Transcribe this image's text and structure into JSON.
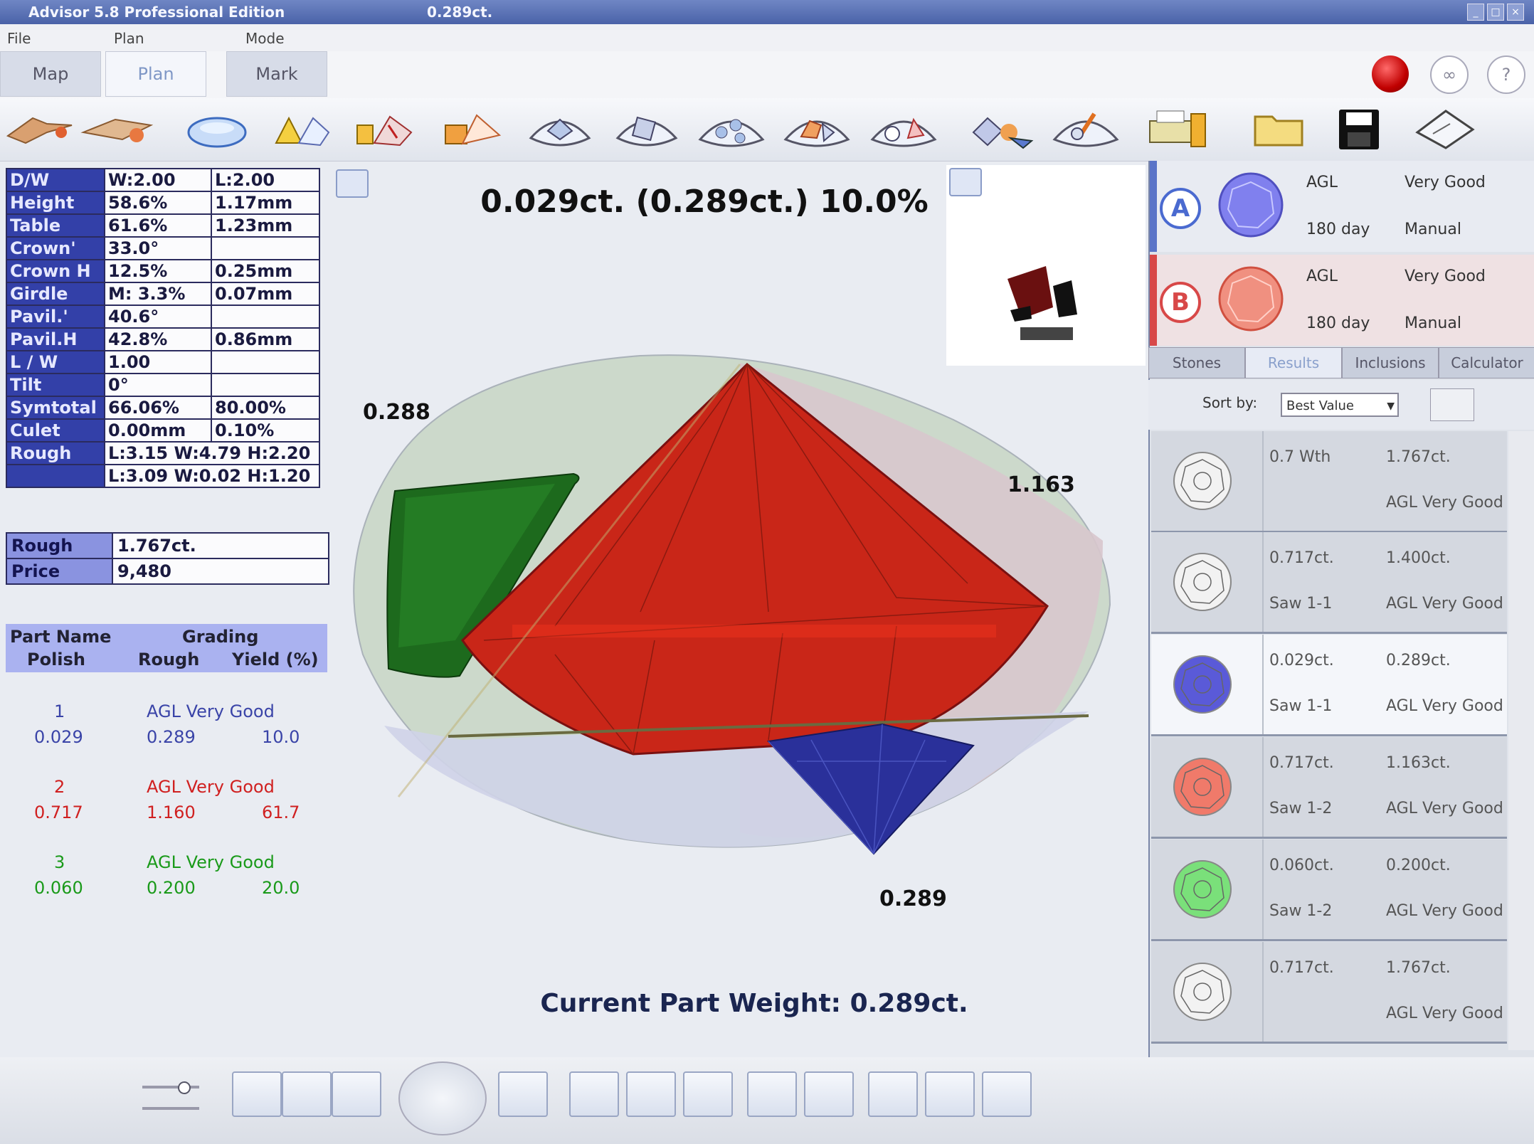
{
  "window": {
    "title": "Advisor 5.8 Professional Edition",
    "title_right": "0.289ct."
  },
  "menu": [
    "File",
    "Plan",
    "Mode"
  ],
  "tabs": [
    {
      "label": "Map",
      "active": false
    },
    {
      "label": "Plan",
      "active": true
    },
    {
      "label": "Mark",
      "active": false
    }
  ],
  "top_right_buttons": [
    "stop-icon",
    "glasses-icon",
    "help-icon"
  ],
  "toolbar_icons": [
    "laser-icon",
    "laser-alt-icon",
    "oval-stone-icon",
    "warning-stone-icon",
    "ruby-stone-icon",
    "multi-stone-icon",
    "round-cut-icon",
    "square-cut-icon",
    "cluster-icon",
    "heart-cut-icon",
    "pear-cut-icon",
    "group-icon",
    "tools-icon",
    "printer-icon",
    "folder-icon",
    "save-icon",
    "rough-stone-icon"
  ],
  "params": [
    {
      "label": "D/W",
      "v1": "W:2.00",
      "v2": "L:2.00"
    },
    {
      "label": "Height",
      "v1": "58.6%",
      "v2": "1.17mm"
    },
    {
      "label": "Table",
      "v1": "61.6%",
      "v2": "1.23mm"
    },
    {
      "label": "Crown'",
      "v1": "33.0°",
      "v2": ""
    },
    {
      "label": "Crown H",
      "v1": "12.5%",
      "v2": "0.25mm"
    },
    {
      "label": "Girdle",
      "v1": "M: 3.3%",
      "v2": "0.07mm"
    },
    {
      "label": "Pavil.'",
      "v1": "40.6°",
      "v2": ""
    },
    {
      "label": "Pavil.H",
      "v1": "42.8%",
      "v2": "0.86mm"
    },
    {
      "label": "L / W",
      "v1": "1.00",
      "v2": ""
    },
    {
      "label": "Tilt",
      "v1": "0°",
      "v2": ""
    },
    {
      "label": "Symtotal",
      "v1": "66.06%",
      "v2": "80.00%"
    },
    {
      "label": "Culet",
      "v1": "0.00mm",
      "v2": "0.10%"
    },
    {
      "label": "Rough",
      "v1": "L:3.15 W:4.79 H:2.20",
      "v2": ""
    },
    {
      "label": "",
      "v1": "L:3.09 W:0.02 H:1.20",
      "v2": ""
    }
  ],
  "rough_summary": [
    {
      "label": "Rough",
      "value": "1.767ct."
    },
    {
      "label": "Price",
      "value": "9,480"
    }
  ],
  "parts_header": {
    "part_name": "Part Name",
    "grading": "Grading",
    "polish": "Polish",
    "rough": "Rough",
    "yield": "Yield (%)"
  },
  "parts": [
    {
      "name": "1",
      "grading": "AGL Very Good",
      "polish": "0.029",
      "rough": "0.289",
      "yield": "10.0",
      "color": "#3a44a8"
    },
    {
      "name": "2",
      "grading": "AGL Very Good",
      "polish": "0.717",
      "rough": "1.160",
      "yield": "61.7",
      "color": "#d02020"
    },
    {
      "name": "3",
      "grading": "AGL Very Good",
      "polish": "0.060",
      "rough": "0.200",
      "yield": "20.0",
      "color": "#1a9a1a"
    }
  ],
  "headline": "0.029ct. (0.289ct.) 10.0%",
  "stone_labels": {
    "green": "0.288",
    "red": "1.163",
    "blue": "0.289"
  },
  "current_part_weight": "Current Part Weight: 0.289ct.",
  "options": [
    {
      "badge": "A",
      "grade": "AGL",
      "quality": "Very Good",
      "price": "180 day",
      "mode": "Manual",
      "color": "#4a5acc"
    },
    {
      "badge": "B",
      "grade": "AGL",
      "quality": "Very Good",
      "price": "180 day",
      "mode": "Manual",
      "color": "#d84040"
    }
  ],
  "right_tabs": [
    {
      "label": "Stones",
      "active": false
    },
    {
      "label": "Results",
      "active": true
    },
    {
      "label": "Inclusions",
      "active": false
    },
    {
      "label": "Calculator",
      "active": false
    }
  ],
  "sort": {
    "label": "Sort by:",
    "value": "Best Value"
  },
  "candidates": [
    {
      "w1": "0.7 Wth",
      "w2": "1.767ct.",
      "sub1": "",
      "sub2": "AGL Very Good",
      "color": "#c9c9c9",
      "selected": false
    },
    {
      "w1": "0.717ct.",
      "w2": "1.400ct.",
      "sub1": "Saw 1-1",
      "sub2": "AGL Very Good",
      "color": "#c9c9c9",
      "selected": false
    },
    {
      "w1": "0.029ct.",
      "w2": "0.289ct.",
      "sub1": "Saw 1-1",
      "sub2": "AGL Very Good",
      "color": "#5a5ad8",
      "selected": true
    },
    {
      "w1": "0.717ct.",
      "w2": "1.163ct.",
      "sub1": "Saw 1-2",
      "sub2": "AGL Very Good",
      "color": "#f07a6a",
      "selected": false
    },
    {
      "w1": "0.060ct.",
      "w2": "0.200ct.",
      "sub1": "Saw 1-2",
      "sub2": "AGL Very Good",
      "color": "#7ae07a",
      "selected": false
    },
    {
      "w1": "0.717ct.",
      "w2": "1.767ct.",
      "sub1": "",
      "sub2": "AGL Very Good",
      "color": "#c9c9c9",
      "selected": false
    }
  ],
  "bottom_icons": [
    "round-view-icon",
    "side-view-icon",
    "pavilion-view-icon",
    "rotate-icon",
    "edit-icon",
    "circle-outline-icon",
    "triangle-icon",
    "gem-icon",
    "zoom-in-icon",
    "zoom-area-icon",
    "multi-view-icon",
    "percent-icon",
    "gem-flat-icon"
  ]
}
